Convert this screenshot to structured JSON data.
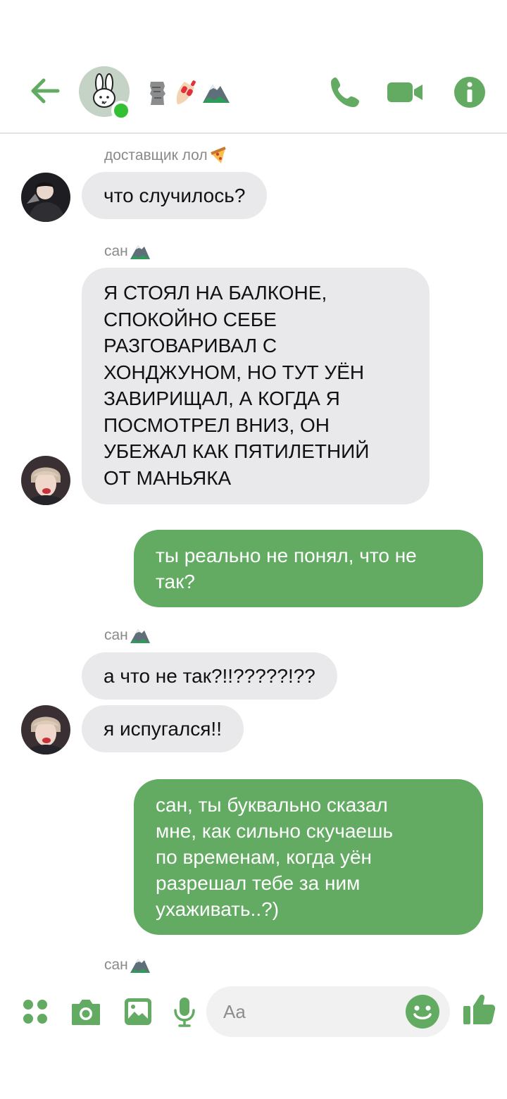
{
  "header": {
    "title_emojis": [
      "moai",
      "nail-polish",
      "mountain"
    ],
    "accent_color": "#63ab63",
    "online_color": "#34c034"
  },
  "messages": [
    {
      "kind": "sender",
      "text": "доставщик лол",
      "emoji": "pizza"
    },
    {
      "kind": "in",
      "text": "что случилось?"
    },
    {
      "kind": "sender",
      "text": "сан",
      "emoji": "mountain"
    },
    {
      "kind": "in",
      "lines": [
        "Я СТОЯЛ НА БАЛКОНЕ,",
        "СПОКОЙНО СЕБЕ",
        "РАЗГОВАРИВАЛ С",
        "ХОНДЖУНОМ, НО ТУТ УЁН",
        "ЗАВИРИЩАЛ, А КОГДА Я",
        "ПОСМОТРЕЛ ВНИЗ, ОН",
        "УБЕЖАЛ КАК ПЯТИЛЕТНИЙ",
        "ОТ МАНЬЯКА"
      ]
    },
    {
      "kind": "out",
      "lines": [
        "ты реально не понял, что не",
        "так?"
      ]
    },
    {
      "kind": "sender",
      "text": "сан",
      "emoji": "mountain"
    },
    {
      "kind": "in",
      "text": "а что не так?!!?????!??"
    },
    {
      "kind": "in",
      "text": "я испугался!!"
    },
    {
      "kind": "out",
      "lines": [
        "сан, ты буквально сказал",
        "мне, как сильно скучаешь",
        "по временам, когда уён",
        "разрешал тебе за ним",
        "ухаживать..?)"
      ]
    },
    {
      "kind": "sender",
      "text": "сан",
      "emoji": "mountain"
    }
  ],
  "composer": {
    "placeholder": "Aa",
    "bubble_colors": {
      "incoming": "#e9e8eb",
      "outgoing": "#63ab63"
    }
  }
}
